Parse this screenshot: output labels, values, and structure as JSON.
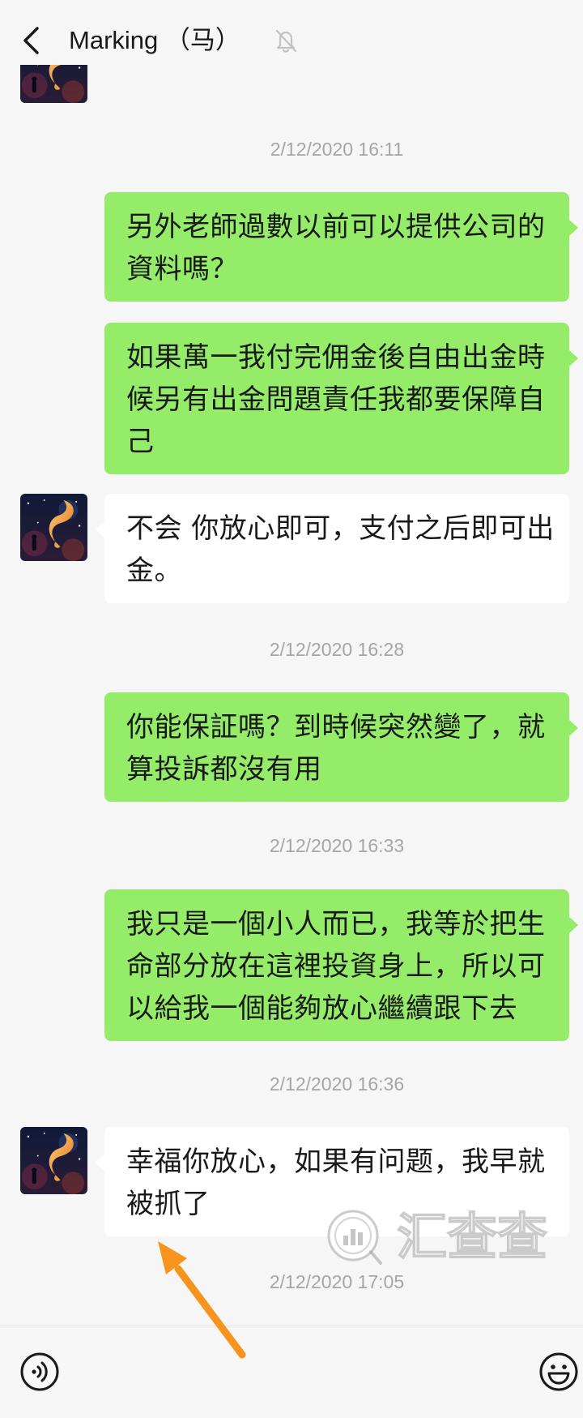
{
  "header": {
    "title": "Marking （马）",
    "back_icon": "chevron-left-icon",
    "mute_icon": "bell-muted-icon"
  },
  "timestamps": [
    "2/12/2020 16:11",
    "2/12/2020 16:28",
    "2/12/2020 16:33",
    "2/12/2020 16:36",
    "2/12/2020 17:05"
  ],
  "messages": [
    {
      "lines": [
        "另外老師過數以前可以提供公司的",
        "資料嗎？"
      ]
    },
    {
      "lines": [
        "如果萬一我付完佣金後自由出金時",
        "候另有出金問題責任我都要保障自",
        "己"
      ]
    },
    {
      "lines": [
        "不会 你放心即可，支付之后即可出",
        "金。"
      ]
    },
    {
      "lines": [
        "你能保証嗎？到時候突然變了，就",
        "算投訴都沒有用"
      ]
    },
    {
      "lines": [
        "我只是一個小人而已，我等於把生",
        "命部分放在這裡投資身上，所以可",
        "以給我一個能夠放心繼續跟下去"
      ]
    },
    {
      "lines": [
        "幸福你放心，如果有问题，我早就",
        "被抓了"
      ]
    }
  ],
  "avatar_icon": "contact-avatar-fish-night",
  "watermark": {
    "text": "汇查查",
    "logo_icon": "bar-chart-circle-icon"
  },
  "annotation": {
    "arrow_icon": "arrow-icon",
    "color": "#f7941d"
  },
  "input_bar": {
    "voice_icon": "voice-icon",
    "emoji_icon": "emoji-icon"
  },
  "colors": {
    "background": "#f6f6f6",
    "outgoing_bubble": "#95ec69",
    "incoming_bubble": "#ffffff",
    "timestamp_text": "#a6a6a6"
  }
}
